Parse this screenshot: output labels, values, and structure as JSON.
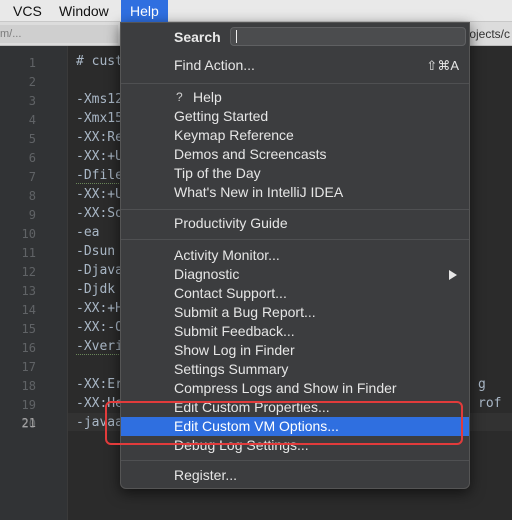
{
  "menubar": {
    "vcs": "VCS",
    "window": "Window",
    "help": "Help"
  },
  "toolbar": {
    "tab_text": "m/...  ",
    "path_text": "ojects/c"
  },
  "editor": {
    "line_numbers": [
      "1",
      "2",
      "3",
      "4",
      "5",
      "6",
      "7",
      "8",
      "9",
      "10",
      "11",
      "12",
      "13",
      "14",
      "15",
      "16",
      "17",
      "18",
      "19",
      "20",
      "21"
    ],
    "current_line": "21",
    "lines": {
      "l1": "# cust",
      "l3": "-Xms12",
      "l4": "-Xmx15",
      "l5": "-XX:Re",
      "l6": "-XX:+U",
      "l7": "-Dfile",
      "l8": "-XX:+U",
      "l9": "-XX:So",
      "l10": "-ea",
      "l11": "-Dsun",
      "l12": "-Djava",
      "l13": "-Djdk",
      "l14": "-XX:+H",
      "l15": "-XX:-O",
      "l16": "-Xveri",
      "l18": "-XX:Er",
      "l19": "-XX:He",
      "l21": "-javaa"
    },
    "right_frag_18": "g",
    "right_frag_19": "rof"
  },
  "help_menu": {
    "search_label": "Search",
    "search_value": "",
    "find_action": "Find Action...",
    "find_action_shortcut": "⇧⌘A",
    "help_item": "Help",
    "help_icon": "question-icon",
    "getting_started": "Getting Started",
    "keymap_reference": "Keymap Reference",
    "demos": "Demos and Screencasts",
    "tip_of_day": "Tip of the Day",
    "whats_new": "What's New in IntelliJ IDEA",
    "productivity_guide": "Productivity Guide",
    "activity_monitor": "Activity Monitor...",
    "diagnostic": "Diagnostic",
    "contact_support": "Contact Support...",
    "submit_bug": "Submit a Bug Report...",
    "submit_feedback": "Submit Feedback...",
    "show_log": "Show Log in Finder",
    "settings_summary": "Settings Summary",
    "compress_logs": "Compress Logs and Show in Finder",
    "edit_custom_properties": "Edit Custom Properties...",
    "edit_custom_vm_options": "Edit Custom VM Options...",
    "debug_log_settings": "Debug Log Settings...",
    "register": "Register..."
  },
  "colors": {
    "selection": "#2f6fe0",
    "annotation": "#e23b3b",
    "menu_bg": "#3c3d3f"
  }
}
